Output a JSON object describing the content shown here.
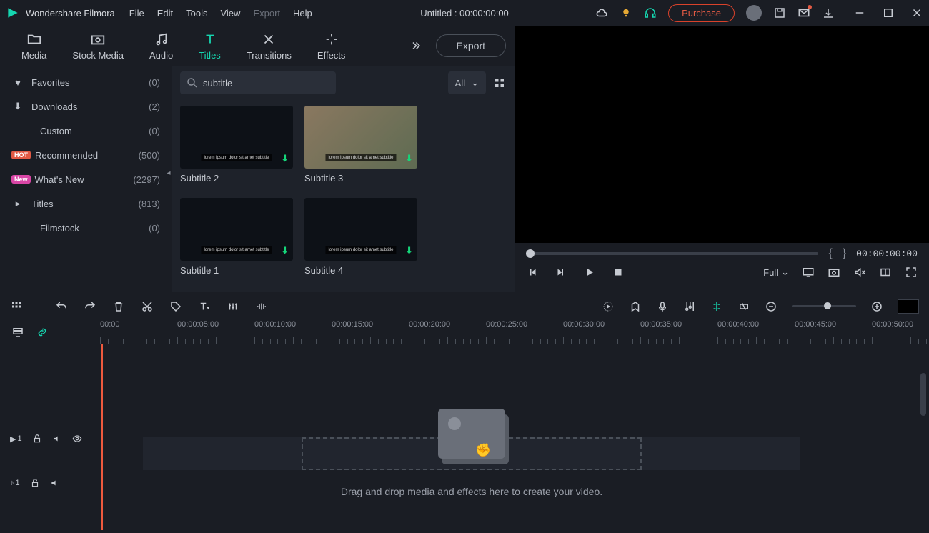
{
  "app_name": "Wondershare Filmora",
  "menus": [
    "File",
    "Edit",
    "Tools",
    "View",
    "Export",
    "Help"
  ],
  "menus_dim_index": 4,
  "project_title": "Untitled : 00:00:00:00",
  "purchase_label": "Purchase",
  "media_tabs": [
    {
      "label": "Media"
    },
    {
      "label": "Stock Media"
    },
    {
      "label": "Audio"
    },
    {
      "label": "Titles"
    },
    {
      "label": "Transitions"
    },
    {
      "label": "Effects"
    }
  ],
  "active_tab_index": 3,
  "export_label": "Export",
  "categories": [
    {
      "icon": "heart",
      "label": "Favorites",
      "count": "(0)"
    },
    {
      "icon": "download",
      "label": "Downloads",
      "count": "(2)"
    },
    {
      "indent": true,
      "label": "Custom",
      "count": "(0)"
    },
    {
      "badge": "HOT",
      "label": "Recommended",
      "count": "(500)"
    },
    {
      "badge": "New",
      "label": "What's New",
      "count": "(2297)"
    },
    {
      "icon": "caret",
      "label": "Titles",
      "count": "(813)"
    },
    {
      "indent": true,
      "label": "Filmstock",
      "count": "(0)"
    }
  ],
  "search": {
    "value": "subtitle"
  },
  "filter_label": "All",
  "thumbnails": [
    {
      "label": "Subtitle 2",
      "photo": false
    },
    {
      "label": "Subtitle 3",
      "photo": true
    },
    {
      "label": "Subtitle 1",
      "photo": false
    },
    {
      "label": "Subtitle 4",
      "photo": false
    }
  ],
  "preview": {
    "timecode": "00:00:00:00",
    "quality": "Full"
  },
  "ruler": [
    "00:00",
    "00:00:05:00",
    "00:00:10:00",
    "00:00:15:00",
    "00:00:20:00",
    "00:00:25:00",
    "00:00:30:00",
    "00:00:35:00",
    "00:00:40:00",
    "00:00:45:00",
    "00:00:50:00"
  ],
  "dropzone_text": "Drag and drop media and effects here to create your video.",
  "track_video_num": "1",
  "track_audio_num": "1"
}
